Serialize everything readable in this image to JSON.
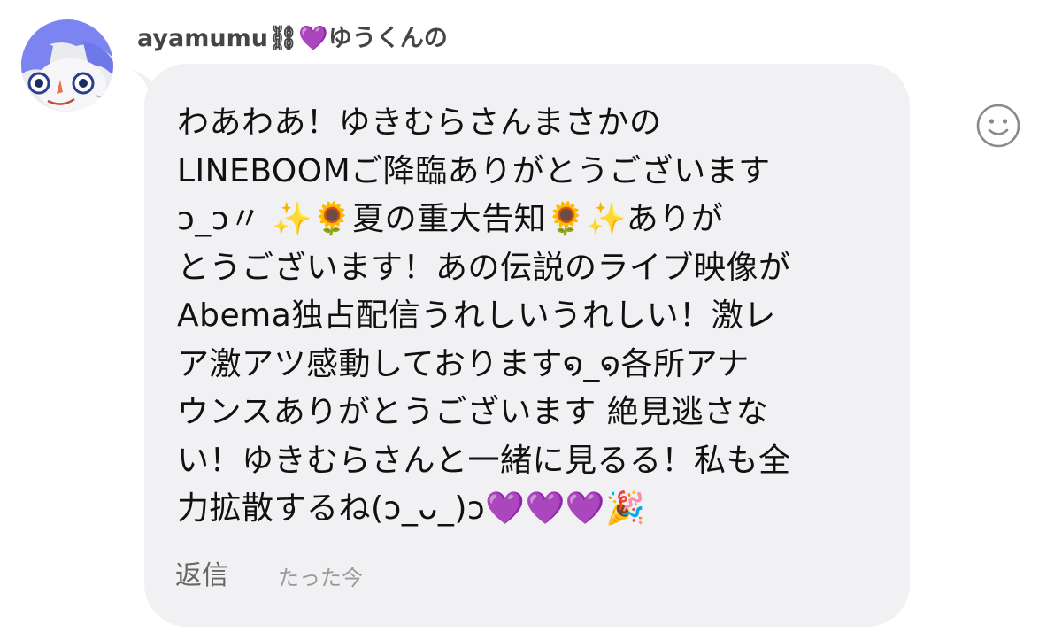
{
  "comment": {
    "username": "ayamumu⛓💜ゆうくんの",
    "message_lines": [
      "わあわあ！ゆきむらさんまさかの",
      "LINEBOOMご降臨ありがとうございます",
      "ↄ_ↄ〃 ✨🌻夏の重大告知🌻✨ありが",
      "とうございます！あの伝説のライブ映像が",
      "Abema独占配信うれしいうれしい！激レ",
      "ア激アツ感動しております໑_໑各所アナ",
      "ウンスありがとうございます 絶見逃さな",
      "い！ゆきむらさんと一緒に見るる！私も全",
      "力拡散するね(ↄ_ᴗ_)ↄ💜💜💜🎉"
    ],
    "reply_label": "返信",
    "timestamp": "たった今"
  },
  "icons": {
    "avatar": "user-avatar",
    "react": "smiley-react-icon"
  },
  "colors": {
    "bubble": "#f1f1f3",
    "username": "#454545",
    "message_text": "#111111",
    "reply_text": "#666666",
    "timestamp_text": "#9a9a9a",
    "avatar_hair": "#7b84f0"
  }
}
